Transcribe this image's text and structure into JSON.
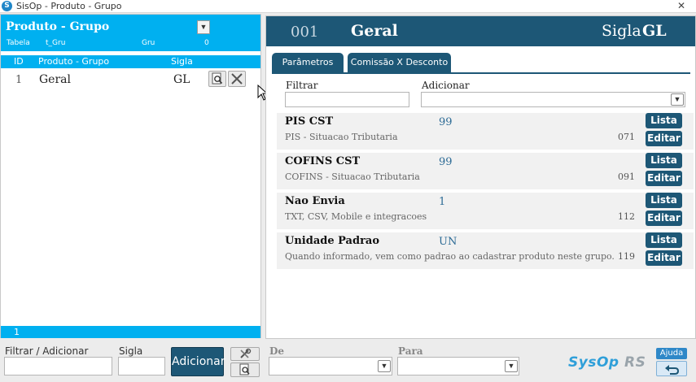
{
  "window": {
    "logo_letter": "S",
    "title": "SisOp - Produto - Grupo",
    "close_glyph": "✕"
  },
  "left": {
    "title": "Produto - Grupo",
    "meta": {
      "tabela": "Tabela",
      "table_name": "t_Gru",
      "field": "Gru",
      "count": "0"
    },
    "columns": {
      "id": "ID",
      "grupo": "Produto - Grupo",
      "sigla": "Sigla"
    },
    "rows": [
      {
        "id": "1",
        "name": "Geral",
        "sigla": "GL"
      }
    ],
    "footer_count": "1"
  },
  "right": {
    "header": {
      "code": "001",
      "name": "Geral",
      "sigla_label": "Sigla",
      "sigla_value": "GL"
    },
    "tabs": [
      {
        "label": "Parâmetros"
      },
      {
        "label": "Comissão X Desconto"
      }
    ],
    "filter_label": "Filtrar",
    "add_label": "Adicionar",
    "params": [
      {
        "name": "PIS CST",
        "description": "PIS - Situacao Tributaria",
        "value": "99",
        "code": "071"
      },
      {
        "name": "COFINS CST",
        "description": "COFINS - Situacao Tributaria",
        "value": "99",
        "code": "091"
      },
      {
        "name": "Nao Envia",
        "description": "TXT, CSV, Mobile e integracoes",
        "value": "1",
        "code": "112"
      },
      {
        "name": "Unidade Padrao",
        "description": "Quando informado, vem como padrao ao cadastrar produto neste grupo.",
        "value": "UN",
        "code": "119"
      }
    ],
    "lista_label": "Lista",
    "editar_label": "Editar"
  },
  "bottom": {
    "filter_label": "Filtrar / Adicionar",
    "sigla_label": "Sigla",
    "add_button": "Adicionar",
    "de_label": "De",
    "para_label": "Para",
    "brand_main": "SysOp",
    "brand_suffix": "RS",
    "help_button": "Ajuda"
  },
  "colors": {
    "cyan_header": "#00b0f0",
    "navy": "#1d5776",
    "value_blue": "#2b6a95",
    "brand_blue": "#2f9fd9"
  }
}
